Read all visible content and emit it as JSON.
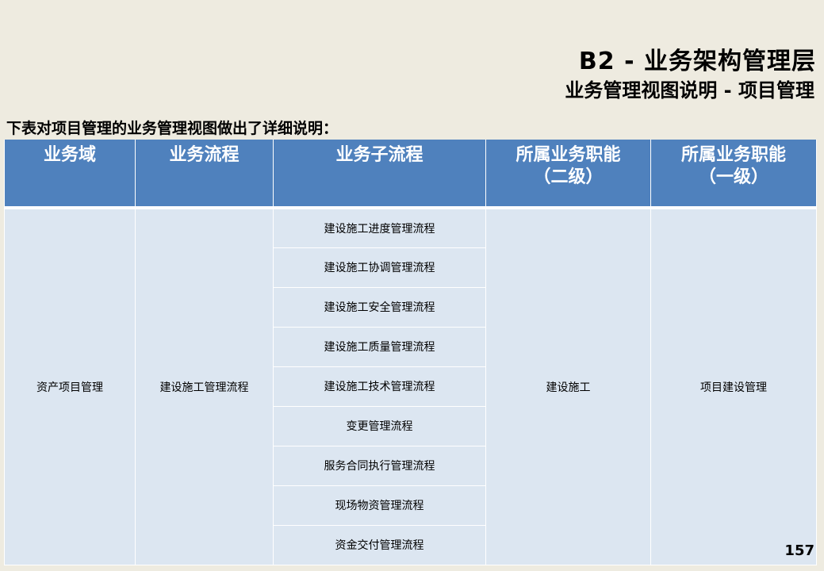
{
  "title": {
    "main": "B2 - 业务架构管理层",
    "sub": "业务管理视图说明 - 项目管理"
  },
  "intro": "下表对项目管理的业务管理视图做出了详细说明：",
  "table": {
    "headers": [
      {
        "line1": "业务域",
        "line2": ""
      },
      {
        "line1": "业务流程",
        "line2": ""
      },
      {
        "line1": "业务子流程",
        "line2": ""
      },
      {
        "line1": "所属业务职能",
        "line2": "（二级）"
      },
      {
        "line1": "所属业务职能",
        "line2": "（一级）"
      }
    ],
    "domain": "资产项目管理",
    "process": "建设施工管理流程",
    "subprocesses": [
      "建设施工进度管理流程",
      "建设施工协调管理流程",
      "建设施工安全管理流程",
      "建设施工质量管理流程",
      "建设施工技术管理流程",
      "变更管理流程",
      "服务合同执行管理流程",
      "现场物资管理流程",
      "资金交付管理流程"
    ],
    "function_level2": "建设施工",
    "function_level1": "项目建设管理"
  },
  "page_number": "157"
}
